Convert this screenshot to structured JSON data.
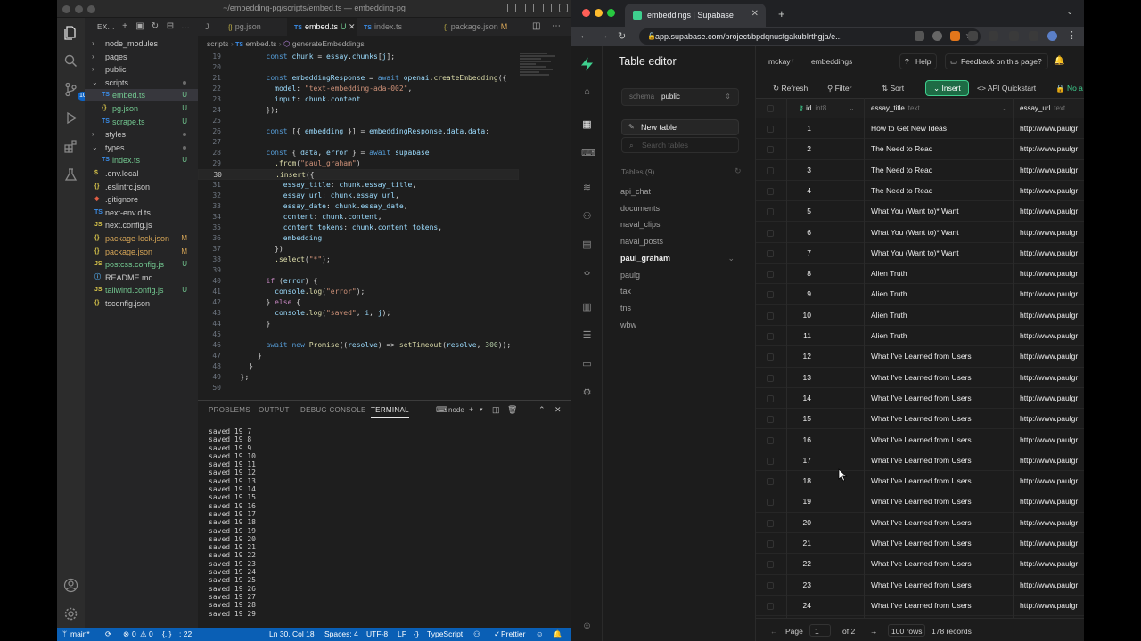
{
  "vscode": {
    "window_title": "~/embedding-pg/scripts/embed.ts — embedding-pg",
    "explorer_title": "EX...",
    "activity_badge": "10",
    "tree": [
      {
        "label": "node_modules",
        "type": "folder",
        "open": false,
        "indent": 0,
        "status": ""
      },
      {
        "label": "pages",
        "type": "folder",
        "open": false,
        "indent": 0,
        "status": ""
      },
      {
        "label": "public",
        "type": "folder",
        "open": false,
        "indent": 0,
        "status": ""
      },
      {
        "label": "scripts",
        "type": "folder",
        "open": true,
        "indent": 0,
        "status": "dot"
      },
      {
        "label": "embed.ts",
        "type": "ts",
        "indent": 1,
        "status": "U",
        "active": true
      },
      {
        "label": "pg.json",
        "type": "json",
        "indent": 1,
        "status": "U"
      },
      {
        "label": "scrape.ts",
        "type": "ts",
        "indent": 1,
        "status": "U"
      },
      {
        "label": "styles",
        "type": "folder",
        "open": false,
        "indent": 0,
        "status": "dot"
      },
      {
        "label": "types",
        "type": "folder",
        "open": true,
        "indent": 0,
        "status": "dot"
      },
      {
        "label": "index.ts",
        "type": "ts",
        "indent": 1,
        "status": "U"
      },
      {
        "label": ".env.local",
        "type": "env",
        "indent": 0,
        "status": ""
      },
      {
        "label": ".eslintrc.json",
        "type": "json",
        "indent": 0,
        "status": ""
      },
      {
        "label": ".gitignore",
        "type": "git",
        "indent": 0,
        "status": ""
      },
      {
        "label": "next-env.d.ts",
        "type": "ts",
        "indent": 0,
        "status": ""
      },
      {
        "label": "next.config.js",
        "type": "js",
        "indent": 0,
        "status": ""
      },
      {
        "label": "package-lock.json",
        "type": "json",
        "indent": 0,
        "status": "M"
      },
      {
        "label": "package.json",
        "type": "json",
        "indent": 0,
        "status": "M"
      },
      {
        "label": "postcss.config.js",
        "type": "js",
        "indent": 0,
        "status": "U"
      },
      {
        "label": "README.md",
        "type": "md",
        "indent": 0,
        "status": ""
      },
      {
        "label": "tailwind.config.js",
        "type": "js",
        "indent": 0,
        "status": "U"
      },
      {
        "label": "tsconfig.json",
        "type": "json",
        "indent": 0,
        "status": ""
      }
    ],
    "tabs": [
      {
        "label": "J",
        "kind": "",
        "status": ""
      },
      {
        "label": "pg.json",
        "kind": "json",
        "status": ""
      },
      {
        "label": "embed.ts",
        "kind": "ts",
        "status": "U",
        "active": true
      },
      {
        "label": "index.ts",
        "kind": "ts",
        "status": ""
      },
      {
        "label": "package.json",
        "kind": "json",
        "status": "M"
      }
    ],
    "breadcrumb": [
      "scripts",
      "embed.ts",
      "generateEmbeddings"
    ],
    "code_lines": [
      {
        "n": "19",
        "t": "        const chunk = essay.chunks[j];"
      },
      {
        "n": "20",
        "t": ""
      },
      {
        "n": "21",
        "t": "        const embeddingResponse = await openai.createEmbedding({"
      },
      {
        "n": "22",
        "t": "          model: \"text-embedding-ada-002\","
      },
      {
        "n": "23",
        "t": "          input: chunk.content"
      },
      {
        "n": "24",
        "t": "        });"
      },
      {
        "n": "25",
        "t": ""
      },
      {
        "n": "26",
        "t": "        const [{ embedding }] = embeddingResponse.data.data;"
      },
      {
        "n": "27",
        "t": ""
      },
      {
        "n": "28",
        "t": "        const { data, error } = await supabase"
      },
      {
        "n": "29",
        "t": "          .from(\"paul_graham\")"
      },
      {
        "n": "30",
        "t": "          .insert({"
      },
      {
        "n": "31",
        "t": "            essay_title: chunk.essay_title,"
      },
      {
        "n": "32",
        "t": "            essay_url: chunk.essay_url,"
      },
      {
        "n": "33",
        "t": "            essay_date: chunk.essay_date,"
      },
      {
        "n": "34",
        "t": "            content: chunk.content,"
      },
      {
        "n": "35",
        "t": "            content_tokens: chunk.content_tokens,"
      },
      {
        "n": "36",
        "t": "            embedding"
      },
      {
        "n": "37",
        "t": "          })"
      },
      {
        "n": "38",
        "t": "          .select(\"*\");"
      },
      {
        "n": "39",
        "t": ""
      },
      {
        "n": "40",
        "t": "        if (error) {"
      },
      {
        "n": "41",
        "t": "          console.log(\"error\");"
      },
      {
        "n": "42",
        "t": "        } else {"
      },
      {
        "n": "43",
        "t": "          console.log(\"saved\", i, j);"
      },
      {
        "n": "44",
        "t": "        }"
      },
      {
        "n": "45",
        "t": ""
      },
      {
        "n": "46",
        "t": "        await new Promise((resolve) => setTimeout(resolve, 300));"
      },
      {
        "n": "47",
        "t": "      }"
      },
      {
        "n": "48",
        "t": "    }"
      },
      {
        "n": "49",
        "t": "  };"
      },
      {
        "n": "50",
        "t": ""
      }
    ],
    "current_line": "30",
    "panel_tabs": [
      "PROBLEMS",
      "OUTPUT",
      "DEBUG CONSOLE",
      "TERMINAL"
    ],
    "terminal_name": "node",
    "terminal_lines": [
      "saved 19 7",
      "saved 19 8",
      "saved 19 9",
      "saved 19 10",
      "saved 19 11",
      "saved 19 12",
      "saved 19 13",
      "saved 19 14",
      "saved 19 15",
      "saved 19 16",
      "saved 19 17",
      "saved 19 18",
      "saved 19 19",
      "saved 19 20",
      "saved 19 21",
      "saved 19 22",
      "saved 19 23",
      "saved 19 24",
      "saved 19 25",
      "saved 19 26",
      "saved 19 27",
      "saved 19 28",
      "saved 19 29"
    ],
    "status": {
      "branch": "main*",
      "errors": "0",
      "warnings": "0",
      "lang_prefix": "{..}",
      "col_count": ": 22",
      "position": "Ln 30, Col 18",
      "spaces": "Spaces: 4",
      "encoding": "UTF-8",
      "eol": "LF",
      "language": "TypeScript",
      "formatter": "Prettier"
    }
  },
  "chrome": {
    "tab_title": "embeddings | Supabase",
    "url": "app.supabase.com/project/bpdqnusfgakubIrthgja/e..."
  },
  "supabase": {
    "page_title": "Table editor",
    "crumbs": [
      "mckay",
      "embeddings"
    ],
    "help_label": "Help",
    "feedback_label": "Feedback on this page?",
    "schema_label": "schema",
    "schema_value": "public",
    "new_table_label": "New table",
    "search_placeholder": "Search tables",
    "tables_header": "Tables (9)",
    "tables": [
      "api_chat",
      "documents",
      "naval_clips",
      "naval_posts",
      "paul_graham",
      "paulg",
      "tax",
      "tns",
      "wbw"
    ],
    "active_table": "paul_graham",
    "toolbar": {
      "refresh": "Refresh",
      "filter": "Filter",
      "sort": "Sort",
      "insert": "Insert",
      "quickstart": "API Quickstart",
      "no_access": "No a"
    },
    "columns": [
      {
        "name": "id",
        "type": "int8"
      },
      {
        "name": "essay_title",
        "type": "text"
      },
      {
        "name": "essay_url",
        "type": "text"
      }
    ],
    "rows": [
      {
        "id": "1",
        "title": "How to Get New Ideas",
        "url": "http://www.paulgr"
      },
      {
        "id": "2",
        "title": "The Need to Read",
        "url": "http://www.paulgr"
      },
      {
        "id": "3",
        "title": "The Need to Read",
        "url": "http://www.paulgr"
      },
      {
        "id": "4",
        "title": "The Need to Read",
        "url": "http://www.paulgr"
      },
      {
        "id": "5",
        "title": "What You (Want to)* Want",
        "url": "http://www.paulgr"
      },
      {
        "id": "6",
        "title": "What You (Want to)* Want",
        "url": "http://www.paulgr"
      },
      {
        "id": "7",
        "title": "What You (Want to)* Want",
        "url": "http://www.paulgr"
      },
      {
        "id": "8",
        "title": "Alien Truth",
        "url": "http://www.paulgr"
      },
      {
        "id": "9",
        "title": "Alien Truth",
        "url": "http://www.paulgr"
      },
      {
        "id": "10",
        "title": "Alien Truth",
        "url": "http://www.paulgr"
      },
      {
        "id": "11",
        "title": "Alien Truth",
        "url": "http://www.paulgr"
      },
      {
        "id": "12",
        "title": "What I've Learned from Users",
        "url": "http://www.paulgr"
      },
      {
        "id": "13",
        "title": "What I've Learned from Users",
        "url": "http://www.paulgr"
      },
      {
        "id": "14",
        "title": "What I've Learned from Users",
        "url": "http://www.paulgr"
      },
      {
        "id": "15",
        "title": "What I've Learned from Users",
        "url": "http://www.paulgr"
      },
      {
        "id": "16",
        "title": "What I've Learned from Users",
        "url": "http://www.paulgr"
      },
      {
        "id": "17",
        "title": "What I've Learned from Users",
        "url": "http://www.paulgr"
      },
      {
        "id": "18",
        "title": "What I've Learned from Users",
        "url": "http://www.paulgr"
      },
      {
        "id": "19",
        "title": "What I've Learned from Users",
        "url": "http://www.paulgr"
      },
      {
        "id": "20",
        "title": "What I've Learned from Users",
        "url": "http://www.paulgr"
      },
      {
        "id": "21",
        "title": "What I've Learned from Users",
        "url": "http://www.paulgr"
      },
      {
        "id": "22",
        "title": "What I've Learned from Users",
        "url": "http://www.paulgr"
      },
      {
        "id": "23",
        "title": "What I've Learned from Users",
        "url": "http://www.paulgr"
      },
      {
        "id": "24",
        "title": "What I've Learned from Users",
        "url": "http://www.paulgr"
      }
    ],
    "footer": {
      "page_label": "Page",
      "page_value": "1",
      "of_pages": "of 2",
      "rows_per_page": "100 rows",
      "records": "178 records"
    }
  },
  "colors": {
    "vscode_status": "#0a5fb5",
    "supabase_green": "#3ecf8e",
    "ts_blue": "#3b8eea",
    "modified": "#d7a657",
    "untracked": "#73c991"
  }
}
